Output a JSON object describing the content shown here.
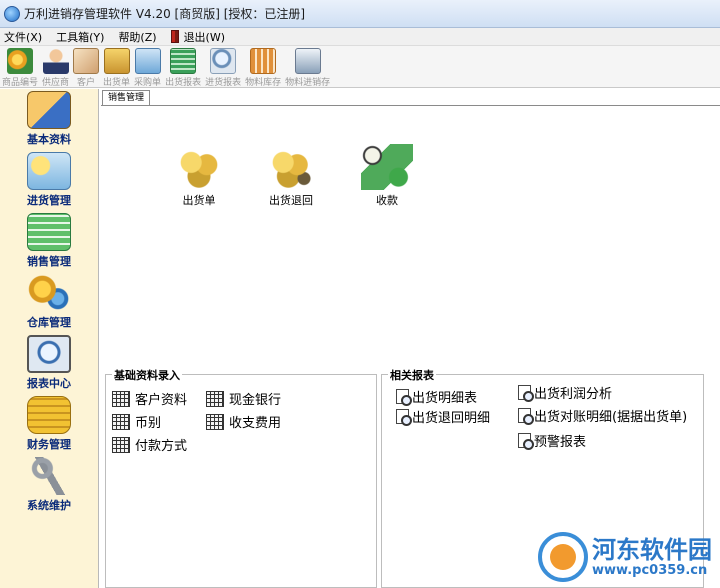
{
  "window": {
    "title": "万利进销存管理软件 V4.20 [商贸版] [授权：已注册]"
  },
  "menu": [
    {
      "label": "文件(X)"
    },
    {
      "label": "工具箱(Y)"
    },
    {
      "label": "帮助(Z)"
    },
    {
      "label": "退出(W)"
    }
  ],
  "toolbar": [
    {
      "label": "商品编号",
      "icon": "gear-flower-icon",
      "color": "#e9a020"
    },
    {
      "label": "供应商",
      "icon": "person-icon",
      "color": "#c98a50"
    },
    {
      "label": "客户",
      "icon": "card-icon",
      "color": "#d0a070"
    },
    {
      "label": "出货单",
      "icon": "boxes-icon",
      "color": "#d9b040"
    },
    {
      "label": "采购单",
      "icon": "truck-icon",
      "color": "#6fa8d8"
    },
    {
      "label": "出货报表",
      "icon": "report-green-icon",
      "color": "#3aa05a"
    },
    {
      "label": "进货报表",
      "icon": "magnifier-icon",
      "color": "#6a8fb8"
    },
    {
      "label": "物料库存",
      "icon": "chart-icon",
      "color": "#e0903a"
    },
    {
      "label": "物料进销存",
      "icon": "stock-icon",
      "color": "#8aa0b8"
    }
  ],
  "sidebar": [
    {
      "label": "基本资料",
      "icon": "clipboard-icon"
    },
    {
      "label": "进货管理",
      "icon": "coins-docs-icon"
    },
    {
      "label": "销售管理",
      "icon": "money-stack-icon"
    },
    {
      "label": "仓库管理",
      "icon": "gears-icon"
    },
    {
      "label": "报表中心",
      "icon": "report-monitor-icon"
    },
    {
      "label": "财务管理",
      "icon": "coin-stack-icon"
    },
    {
      "label": "系统维护",
      "icon": "keys-icon"
    }
  ],
  "tab": {
    "label": "销售管理"
  },
  "modules": [
    {
      "label": "出货单",
      "icon": "shipment-icon"
    },
    {
      "label": "出货退回",
      "icon": "return-icon"
    },
    {
      "label": "收款",
      "icon": "collect-money-icon"
    }
  ],
  "basic_entry": {
    "title": "基础资料录入",
    "items": [
      {
        "label": "客户资料"
      },
      {
        "label": "现金银行"
      },
      {
        "label": "币别"
      },
      {
        "label": "收支费用"
      },
      {
        "label": "付款方式"
      }
    ]
  },
  "reports": {
    "title": "相关报表",
    "items": [
      {
        "label": "出货明细表"
      },
      {
        "label": "出货利润分析"
      },
      {
        "label": "出货退回明细"
      },
      {
        "label": "出货对账明细(据据出货单)"
      },
      {
        "label": "预警报表"
      }
    ]
  },
  "watermark": {
    "name": "河东软件园",
    "url": "www.pc0359.cn"
  }
}
